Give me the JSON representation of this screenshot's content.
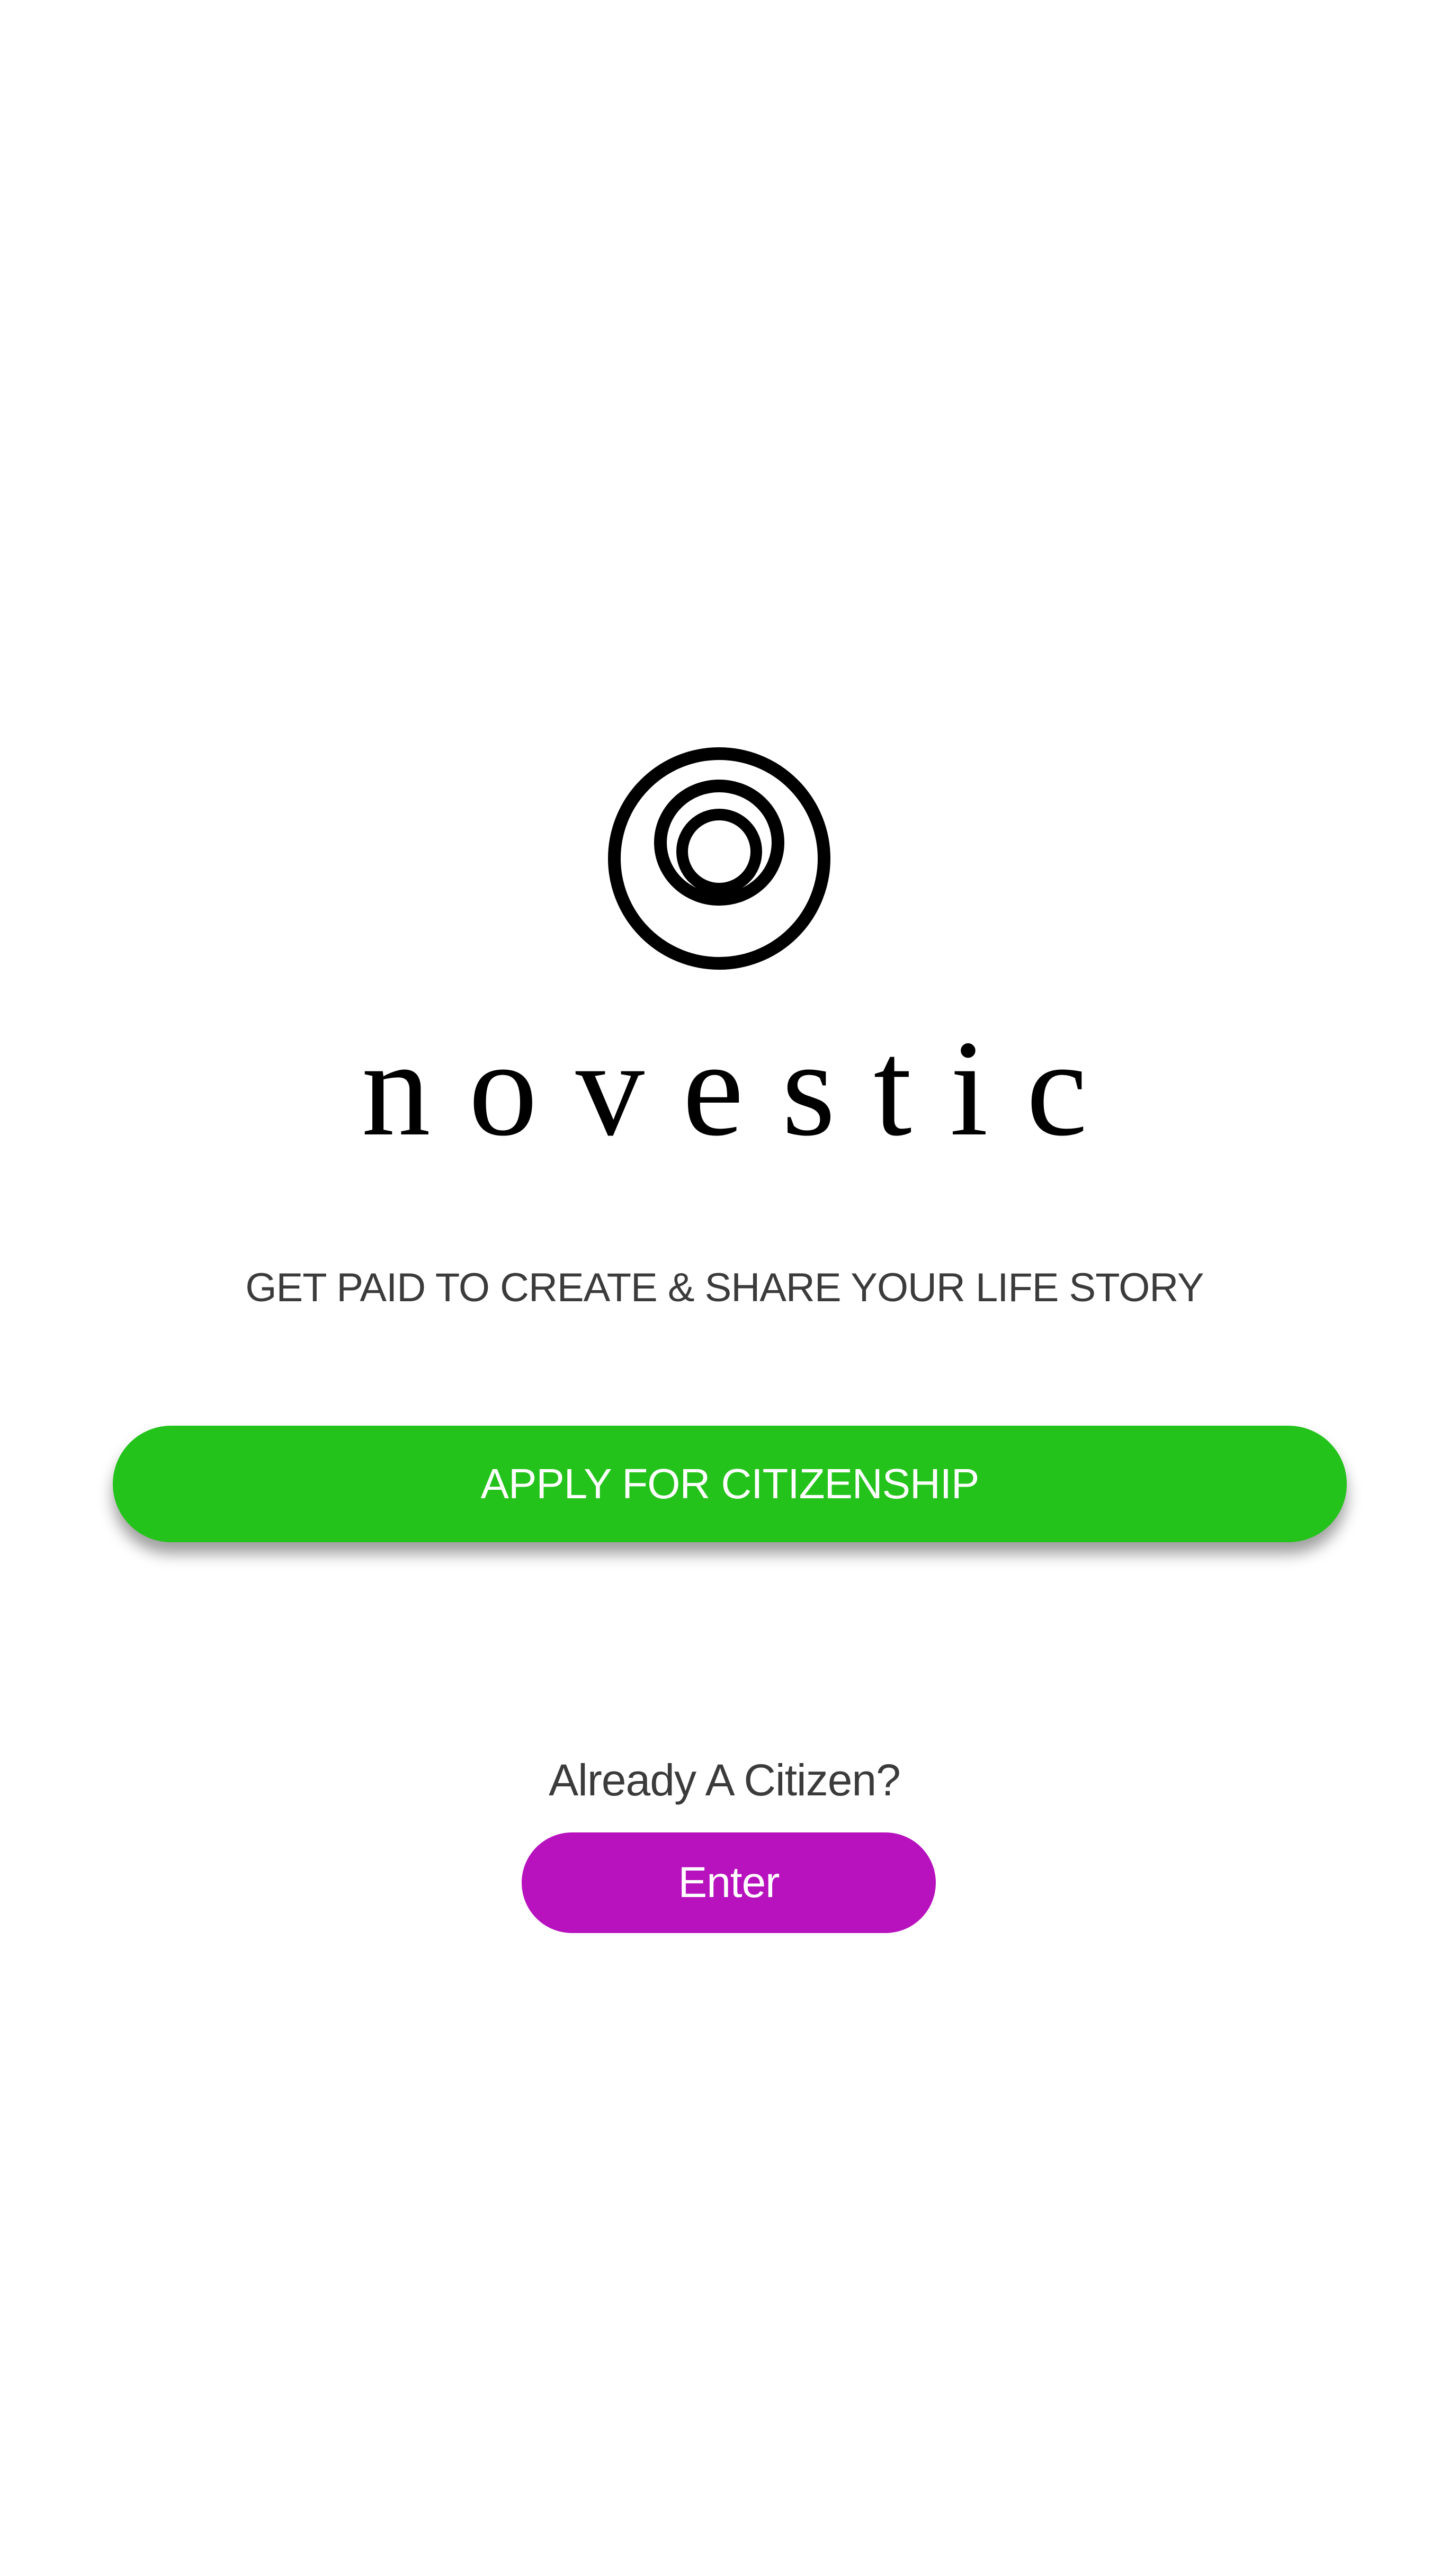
{
  "app": {
    "name": "novestic",
    "logo_icon": "concentric-circles-logo-icon"
  },
  "landing": {
    "tagline": "GET PAID TO CREATE & SHARE YOUR LIFE STORY",
    "apply_label": "APPLY FOR CITIZENSHIP",
    "already_citizen_text": "Already A Citizen?",
    "enter_label": "Enter"
  },
  "colors": {
    "background": "#ffffff",
    "apply_button": "#24c31b",
    "enter_button": "#b712be",
    "text_primary": "#000000",
    "text_secondary": "#3b3b3b",
    "button_text": "#ffffff"
  }
}
